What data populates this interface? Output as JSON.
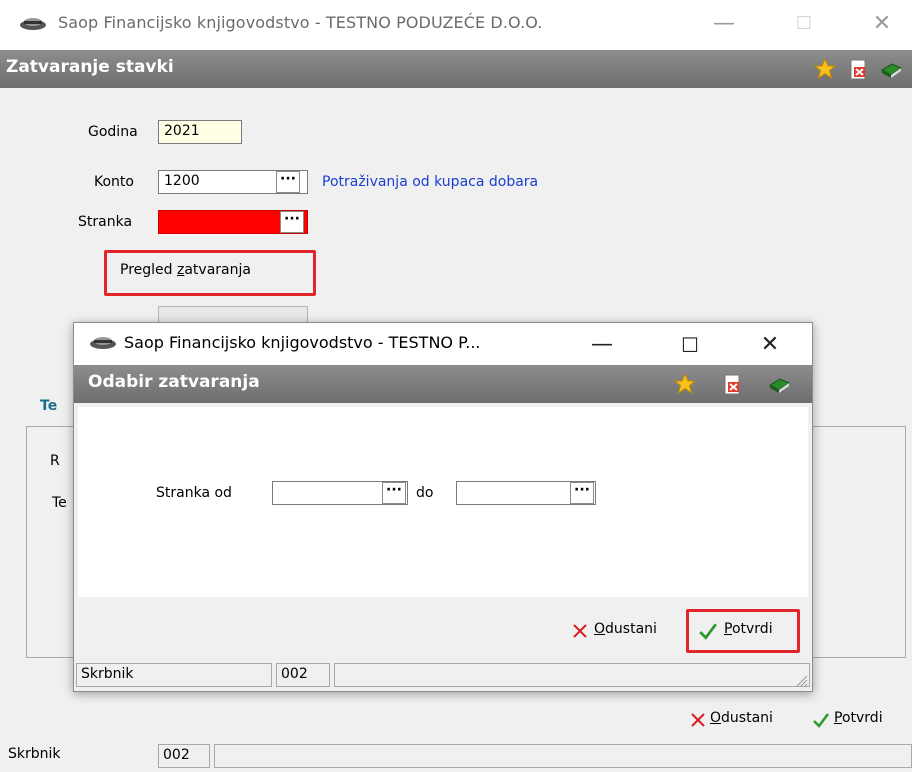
{
  "window": {
    "title": "Saop Financijsko knjigovodstvo - TESTNO PODUZEĆE D.O.O.",
    "minimize_glyph": "—",
    "maximize_glyph": "☐",
    "close_glyph": "✕"
  },
  "header": {
    "title": "Zatvaranje stavki"
  },
  "form": {
    "godina_label": "Godina",
    "godina_value": "2021",
    "konto_label": "Konto",
    "konto_value": "1200",
    "konto_desc": "Potraživanja od kupaca dobara",
    "stranka_label": "Stranka",
    "stranka_value": "",
    "dots": "···",
    "pregled_prefix": "Pregled ",
    "pregled_underlined": "z",
    "pregled_suffix": "atvaranja",
    "hidden_label_1": "Te",
    "hidden_label_2": "R",
    "hidden_label_3": "Te"
  },
  "bottom": {
    "odustani_u": "O",
    "odustani_rest": "dustani",
    "potvrdi_u": "P",
    "potvrdi_rest": "otvrdi"
  },
  "status": {
    "user_label": "Skrbnik",
    "code": "002"
  },
  "dialog": {
    "title": "Saop Financijsko knjigovodstvo - TESTNO P...",
    "minimize_glyph": "—",
    "maximize_glyph": "☐",
    "close_glyph": "✕",
    "header": "Odabir zatvaranja",
    "stranka_od_label": "Stranka od",
    "stranka_od_value": "",
    "do_label": "do",
    "do_value": "",
    "odustani_u": "O",
    "odustani_rest": "dustani",
    "potvrdi_u": "P",
    "potvrdi_rest": "otvrdi",
    "status_user": "Skrbnik",
    "status_code": "002"
  },
  "colors": {
    "highlight_red": "#e0252b",
    "stranka_fill": "#ff0000",
    "link_blue": "#1a3fcf",
    "header_gray": "#7a7a7a"
  }
}
